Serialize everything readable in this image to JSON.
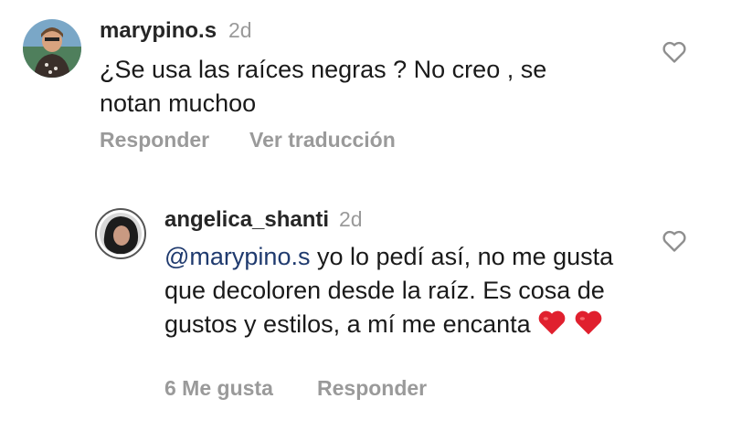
{
  "comments": [
    {
      "username": "marypino.s",
      "time": "2d",
      "text": "¿Se usa las raíces negras ? No creo , se notan muchoo",
      "actions": {
        "reply": "Responder",
        "translate": "Ver traducción"
      },
      "icons": {
        "avatar": "avatar-photo",
        "like": "heart-outline-icon"
      }
    },
    {
      "username": "angelica_shanti",
      "time": "2d",
      "mention": "@marypino.s",
      "text": " yo lo pedí así, no me gusta que decoloren desde la raíz. Es cosa de gustos y estilos, a mí me encanta",
      "emoji": [
        "red-heart-emoji",
        "red-heart-emoji"
      ],
      "likes_label": "6 Me gusta",
      "actions": {
        "reply": "Responder"
      },
      "icons": {
        "avatar": "avatar-photo-story-ring",
        "like": "heart-outline-icon"
      }
    }
  ],
  "colors": {
    "secondary_text": "#9a9a9a",
    "mention": "#1f3a6e",
    "heart_emoji": "#e0202e"
  }
}
